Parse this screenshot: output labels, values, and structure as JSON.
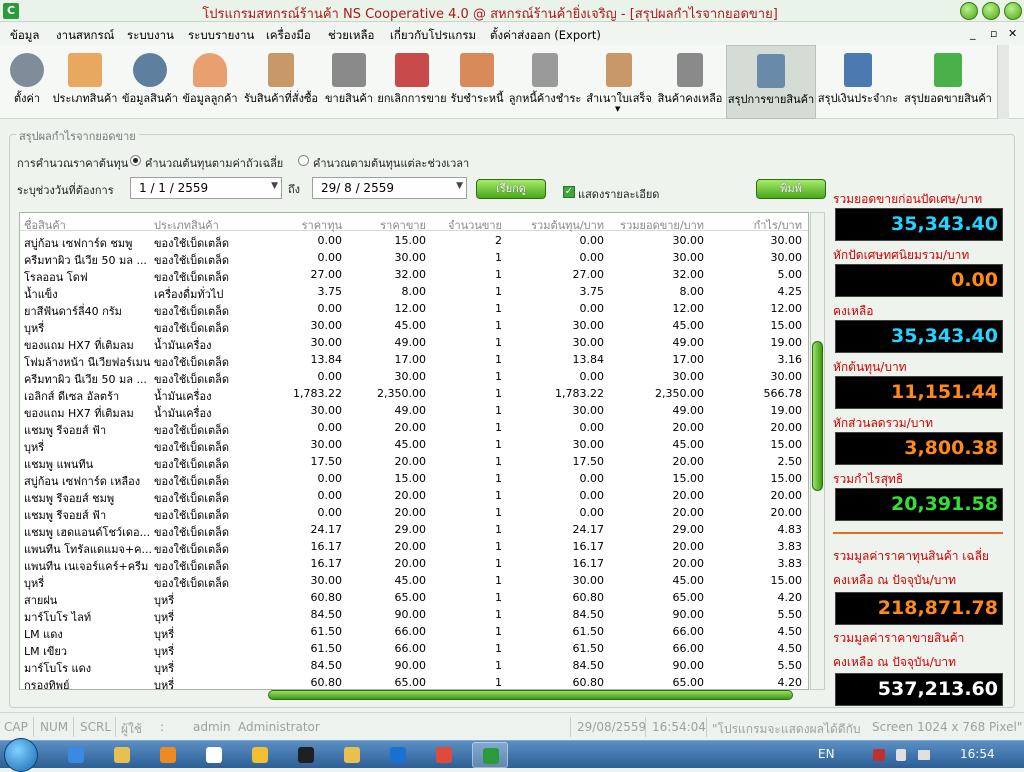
{
  "window": {
    "title": "โปรแกรมสหกรณ์ร้านค้า NS Cooperative 4.0 @ สหกรณ์ร้านค้ายิ่งเจริญ - [สรุปผลกำไรจากยอดขาย]",
    "app_icon": "C"
  },
  "menu": [
    "ข้อมูล",
    "งานสหกรณ์",
    "ระบบงาน",
    "ระบบรายงาน",
    "เครื่องมือ",
    "ช่วยเหลือ",
    "เกี่ยวกับโปรแกรม",
    "ตั้งค่าส่งออก (Export)"
  ],
  "mdi_controls": [
    "_",
    "▫",
    "✕"
  ],
  "toolbar": [
    {
      "label": "ตั้งค่า",
      "icon": "gear-icon",
      "color": "#7f8c99"
    },
    {
      "label": "ประเภทสินค้า",
      "icon": "folder-icon",
      "color": "#e8a860"
    },
    {
      "label": "ข้อมูลสินค้า",
      "icon": "barcode-icon",
      "color": "#5f7f9f"
    },
    {
      "label": "ข้อมูลลูกค้า",
      "icon": "customer-icon",
      "color": "#e8a070"
    },
    {
      "label": "รับสินค้าที่สั่งซื้อ",
      "icon": "clipboard-icon",
      "color": "#c89868"
    },
    {
      "label": "ขายสินค้า",
      "icon": "cart-icon",
      "color": "#8a8a8a"
    },
    {
      "label": "ยกเลิกการขาย",
      "icon": "cart-cancel-icon",
      "color": "#c84a4a"
    },
    {
      "label": "รับชำระหนี้",
      "icon": "payment-hand-icon",
      "color": "#d88a5a"
    },
    {
      "label": "ลูกหนี้ค้างชำระ",
      "icon": "debtor-icon",
      "color": "#9a9a9a"
    },
    {
      "label": "สำเนาใบเสร็จ",
      "icon": "receipt-icon",
      "color": "#c89868"
    },
    {
      "label": "สินค้าคงเหลือ",
      "icon": "inventory-icon",
      "color": "#8a8a8a"
    },
    {
      "label": "สรุปการขายสินค้า",
      "icon": "sales-summary-icon",
      "color": "#6a8aaa"
    },
    {
      "label": "สรุปเงินประจำกะ",
      "icon": "calendar-icon",
      "color": "#4a7ab0"
    },
    {
      "label": "สรุปยอดขายสินค้า",
      "icon": "bar-chart-icon",
      "color": "#4ab04a"
    }
  ],
  "form": {
    "group_title": "สรุปผลกำไรจากยอดขาย",
    "cost_label": "การคำนวณราคาต้นทุน",
    "radio_avg": "คำนวณต้นทุนตามค่าถัวเฉลี่ย",
    "radio_period": "คำนวณตามต้นทุนแต่ละช่วงเวลา",
    "date_label": "ระบุช่วงวันที่ต้องการ",
    "date_from": "1 / 1 / 2559",
    "date_to_label": "ถึง",
    "date_to": "29/ 8 / 2559",
    "search_button": "เรียกดู",
    "show_detail": "แสดงรายละเอียด",
    "print_button": "พิมพ์"
  },
  "table": {
    "columns": [
      "ชื่อสินค้า",
      "ประเภทสินค้า",
      "ราคาทุน",
      "ราคาขาย",
      "จำนวนขาย",
      "รวมต้นทุน/บาท",
      "รวมยอดขาย/บาท",
      "กำไร/บาท"
    ],
    "rows": [
      [
        "สบู่ก้อน เซฟการ์ด ชมพู",
        "ของใช้เบ็ดเตล็ด",
        "0.00",
        "15.00",
        "2",
        "0.00",
        "30.00",
        "30.00"
      ],
      [
        "ครีมทาผิว นีเวีย 50 มล ...",
        "ของใช้เบ็ดเตล็ด",
        "0.00",
        "30.00",
        "1",
        "0.00",
        "30.00",
        "30.00"
      ],
      [
        "โรลออน โดฟ",
        "ของใช้เบ็ดเตล็ด",
        "27.00",
        "32.00",
        "1",
        "27.00",
        "32.00",
        "5.00"
      ],
      [
        "น้ำแข็ง",
        "เครื่องดื่มทั่วไป",
        "3.75",
        "8.00",
        "1",
        "3.75",
        "8.00",
        "4.25"
      ],
      [
        "ยาสีฟันดาร์ลี่40 กรัม",
        "ของใช้เบ็ดเตล็ด",
        "0.00",
        "12.00",
        "1",
        "0.00",
        "12.00",
        "12.00"
      ],
      [
        "บุหรี่",
        "ของใช้เบ็ดเตล็ด",
        "30.00",
        "45.00",
        "1",
        "30.00",
        "45.00",
        "15.00"
      ],
      [
        "ของแถม HX7 ที่เติมลม",
        "น้ำมันเครื่อง",
        "30.00",
        "49.00",
        "1",
        "30.00",
        "49.00",
        "19.00"
      ],
      [
        "โฟมล้างหน้า นีเวียฟอร์เมน",
        "ของใช้เบ็ดเตล็ด",
        "13.84",
        "17.00",
        "1",
        "13.84",
        "17.00",
        "3.16"
      ],
      [
        "ครีมทาผิว นีเวีย 50 มล ...",
        "ของใช้เบ็ดเตล็ด",
        "0.00",
        "30.00",
        "1",
        "0.00",
        "30.00",
        "30.00"
      ],
      [
        "เอลิกส์ ดีเซล อัลตร้า",
        "น้ำมันเครื่อง",
        "1,783.22",
        "2,350.00",
        "1",
        "1,783.22",
        "2,350.00",
        "566.78"
      ],
      [
        "ของแถม HX7 ที่เติมลม",
        "น้ำมันเครื่อง",
        "30.00",
        "49.00",
        "1",
        "30.00",
        "49.00",
        "19.00"
      ],
      [
        "แชมพู รีจอยส์ ฟ้า",
        "ของใช้เบ็ดเตล็ด",
        "0.00",
        "20.00",
        "1",
        "0.00",
        "20.00",
        "20.00"
      ],
      [
        "บุหรี่",
        "ของใช้เบ็ดเตล็ด",
        "30.00",
        "45.00",
        "1",
        "30.00",
        "45.00",
        "15.00"
      ],
      [
        "แชมพู แพนทีน",
        "ของใช้เบ็ดเตล็ด",
        "17.50",
        "20.00",
        "1",
        "17.50",
        "20.00",
        "2.50"
      ],
      [
        "สบู่ก้อน เซฟการ์ด เหลือง",
        "ของใช้เบ็ดเตล็ด",
        "0.00",
        "15.00",
        "1",
        "0.00",
        "15.00",
        "15.00"
      ],
      [
        "แชมพู รีจอยส์ ชมพู",
        "ของใช้เบ็ดเตล็ด",
        "0.00",
        "20.00",
        "1",
        "0.00",
        "20.00",
        "20.00"
      ],
      [
        "แชมพู รีจอยส์ ฟ้า",
        "ของใช้เบ็ดเตล็ด",
        "0.00",
        "20.00",
        "1",
        "0.00",
        "20.00",
        "20.00"
      ],
      [
        "แชมพู เฮดแอนด์โชว์เดอ...",
        "ของใช้เบ็ดเตล็ด",
        "24.17",
        "29.00",
        "1",
        "24.17",
        "29.00",
        "4.83"
      ],
      [
        "แพนทีน โทรัลแดแมจ+ค...",
        "ของใช้เบ็ดเตล็ด",
        "16.17",
        "20.00",
        "1",
        "16.17",
        "20.00",
        "3.83"
      ],
      [
        "แพนทีน เนเจอร์แคร์+ครีม",
        "ของใช้เบ็ดเตล็ด",
        "16.17",
        "20.00",
        "1",
        "16.17",
        "20.00",
        "3.83"
      ],
      [
        "บุหรี่",
        "ของใช้เบ็ดเตล็ด",
        "30.00",
        "45.00",
        "1",
        "30.00",
        "45.00",
        "15.00"
      ],
      [
        "สายฝน",
        "บุหรี่",
        "60.80",
        "65.00",
        "1",
        "60.80",
        "65.00",
        "4.20"
      ],
      [
        "มาร์โบโร ไลท์",
        "บุหรี่",
        "84.50",
        "90.00",
        "1",
        "84.50",
        "90.00",
        "5.50"
      ],
      [
        "LM แดง",
        "บุหรี่",
        "61.50",
        "66.00",
        "1",
        "61.50",
        "66.00",
        "4.50"
      ],
      [
        "LM เขียว",
        "บุหรี่",
        "61.50",
        "66.00",
        "1",
        "61.50",
        "66.00",
        "4.50"
      ],
      [
        "มาร์โบโร แดง",
        "บุหรี่",
        "84.50",
        "90.00",
        "1",
        "84.50",
        "90.00",
        "5.50"
      ],
      [
        "กรองทิพย์",
        "บุหรี่",
        "60.80",
        "65.00",
        "1",
        "60.80",
        "65.00",
        "4.20"
      ]
    ]
  },
  "summary": [
    {
      "label": "รวมยอดขายก่อนปัดเศษ/บาท",
      "value": "35,343.40",
      "color": "#22d4ff"
    },
    {
      "label": "หักปัดเศษทศนิยมรวม/บาท",
      "value": "0.00",
      "color": "#ff8a1a"
    },
    {
      "label": "คงเหลือ",
      "value": "35,343.40",
      "color": "#22d4ff"
    },
    {
      "label": "หักต้นทุน/บาท",
      "value": "11,151.44",
      "color": "#ff8a1a"
    },
    {
      "label": "หักส่วนลดรวม/บาท",
      "value": "3,800.38",
      "color": "#ff8a1a"
    },
    {
      "label": "รวมกำไรสุทธิ",
      "value": "20,391.58",
      "color": "#34e034"
    }
  ],
  "inventory": {
    "cost_label_1": "รวมมูลค่าราคาทุนสินค้า เฉลี่ย",
    "cost_label_2": "คงเหลือ ณ ปัจจุบัน/บาท",
    "cost_value": "218,871.78",
    "cost_color": "#ff8a1a",
    "sale_label_1": "รวมมูลค่าราคาขายสินค้า",
    "sale_label_2": "คงเหลือ ณ ปัจจุบัน/บาท",
    "sale_value": "537,213.60",
    "sale_color": "#ffffff"
  },
  "statusbar": {
    "cap": "CAP",
    "num": "NUM",
    "scrl": "SCRL",
    "user_label": "ผู้ใช้",
    "user_sep": ":",
    "user_id": "admin",
    "user_name": "Administrator",
    "date": "29/08/2559",
    "time": "16:54:04",
    "message": "\"โปรแกรมจะแสดงผลได้ดีกับ",
    "screen": "Screen 1024 x 768 Pixel\""
  },
  "taskbar": {
    "apps": [
      {
        "icon": "internet-explorer-icon",
        "color": "#3a8ae0"
      },
      {
        "icon": "file-explorer-icon",
        "color": "#e8c050"
      },
      {
        "icon": "media-player-icon",
        "color": "#f08a20"
      },
      {
        "icon": "wordpad-icon",
        "color": "#ffffff"
      },
      {
        "icon": "key-icon",
        "color": "#f0c030"
      },
      {
        "icon": "record-icon",
        "color": "#202020"
      },
      {
        "icon": "folder-icon",
        "color": "#e8c050"
      },
      {
        "icon": "teamviewer-icon",
        "color": "#1a70d0"
      },
      {
        "icon": "chrome-icon",
        "color": "#e04a3a"
      },
      {
        "icon": "ns-cooperative-icon",
        "color": "#2a9a3a"
      }
    ],
    "lang": "EN",
    "clock": "16:54"
  }
}
